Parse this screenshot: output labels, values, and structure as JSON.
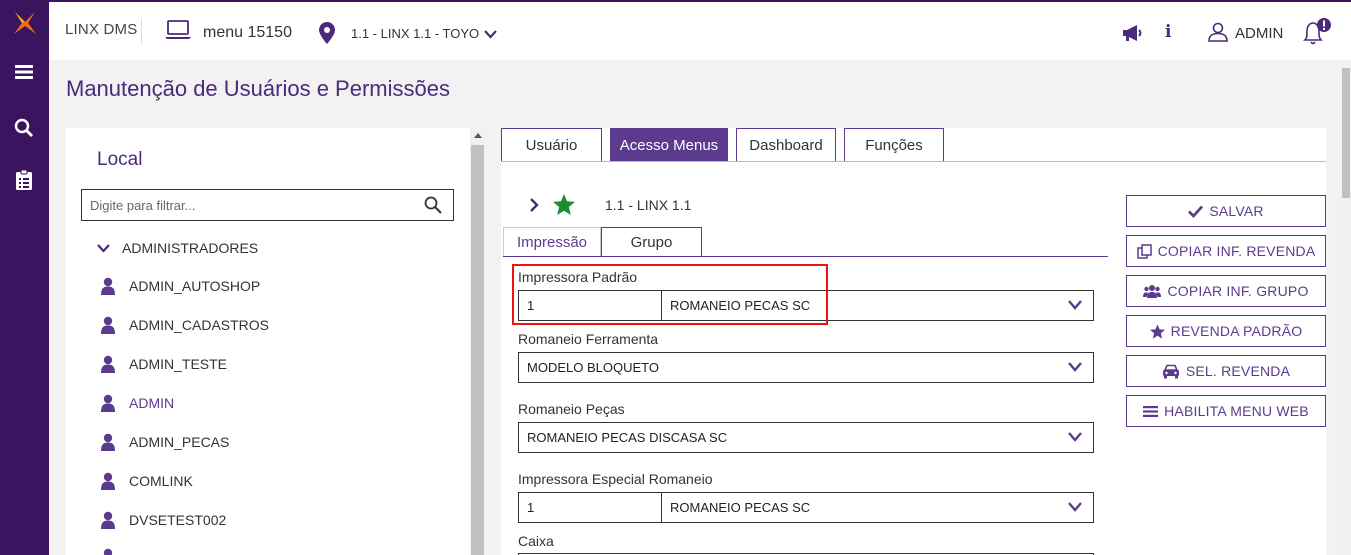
{
  "app": {
    "brand": "LINX DMS",
    "menu": "menu 15150",
    "location": "1.1 - LINX 1.1 - TOYO",
    "user": "ADMIN"
  },
  "rail": {
    "icons": [
      "linx-logo-icon",
      "menu-icon",
      "search-icon",
      "clipboard-icon"
    ]
  },
  "header_icons": [
    "megaphone-icon",
    "info-icon",
    "user-icon",
    "bell-alert-icon"
  ],
  "page": {
    "title": "Manutenção de Usuários e Permissões"
  },
  "left": {
    "title": "Local",
    "filter_placeholder": "Digite para filtrar...",
    "root": "ADMINISTRADORES",
    "items": [
      "ADMIN_AUTOSHOP",
      "ADMIN_CADASTROS",
      "ADMIN_TESTE",
      "ADMIN",
      "ADMIN_PECAS",
      "COMLINK",
      "DVSETEST002"
    ],
    "selected": "ADMIN"
  },
  "tabs": [
    "Usuário",
    "Acesso Menus",
    "Dashboard",
    "Funções"
  ],
  "active_tab": "Acesso Menus",
  "node": {
    "label": "1.1 - LINX 1.1"
  },
  "subtabs": [
    "Impressão",
    "Grupo"
  ],
  "active_subtab": "Impressão",
  "fields": {
    "impressora_padrao": {
      "label": "Impressora Padrão",
      "code": "1",
      "value": "ROMANEIO PECAS SC"
    },
    "romaneio_ferramenta": {
      "label": "Romaneio Ferramenta",
      "value": "MODELO BLOQUETO"
    },
    "romaneio_pecas": {
      "label": "Romaneio Peças",
      "value": "ROMANEIO PECAS DISCASA SC"
    },
    "impressora_especial": {
      "label": "Impressora Especial Romaneio",
      "code": "1",
      "value": "ROMANEIO PECAS SC"
    },
    "caixa": {
      "label": "Caixa"
    }
  },
  "actions": {
    "salvar": "SALVAR",
    "copiar_revenda": "COPIAR INF. REVENDA",
    "copiar_grupo": "COPIAR INF. GRUPO",
    "revenda_padrao": "REVENDA PADRÃO",
    "sel_revenda": "SEL. REVENDA",
    "habilita_menu": "HABILITA MENU WEB"
  },
  "colors": {
    "accent": "#5c3b8f",
    "rail": "#3b1460",
    "highlight": "#e11111",
    "star": "#1f8a2e"
  }
}
